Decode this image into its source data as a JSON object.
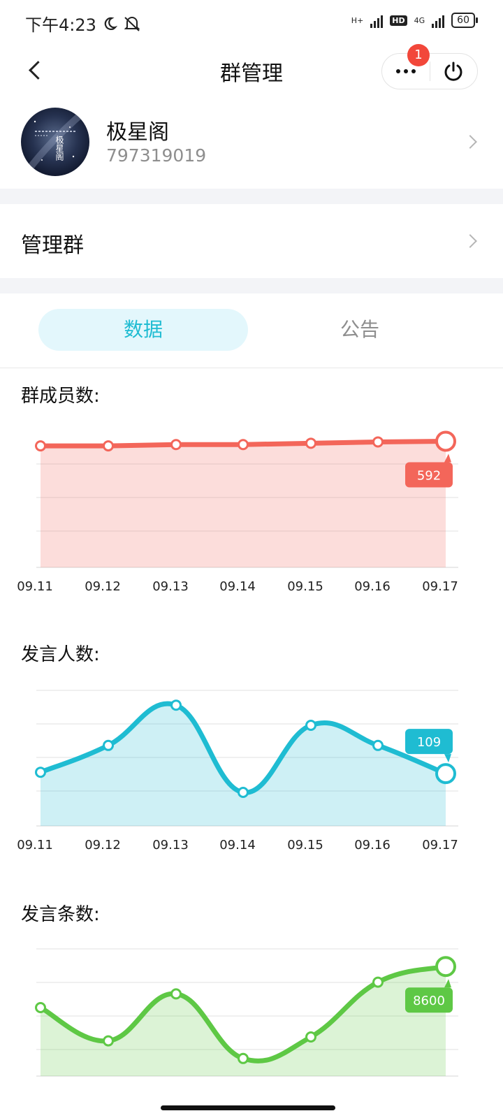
{
  "status_bar": {
    "time": "下午4:23",
    "network_1": "H+",
    "hd": "HD",
    "network_2": "4G",
    "battery": "60",
    "icons": [
      "moon-icon",
      "bell-off-icon",
      "signal-icon",
      "signal-icon",
      "battery-icon"
    ]
  },
  "nav": {
    "title": "群管理",
    "badge_count": "1",
    "icons": [
      "back-icon",
      "more-icon",
      "power-icon"
    ]
  },
  "group": {
    "name": "极星阁",
    "id": "797319019",
    "avatar_text": "极星阁"
  },
  "manage": {
    "label": "管理群"
  },
  "tabs": [
    {
      "label": "数据",
      "active": true
    },
    {
      "label": "公告",
      "active": false
    }
  ],
  "sections": [
    {
      "title": "群成员数:"
    },
    {
      "title": "发言人数:"
    },
    {
      "title": "发言条数:"
    }
  ],
  "colors": {
    "accent": "#1fbcd2",
    "members": "#f3665a",
    "speakers": "#1fbcd2",
    "messages": "#5ec845",
    "badge": "#f2473a"
  },
  "chart_data": [
    {
      "type": "area",
      "title": "群成员数:",
      "categories": [
        "09.11",
        "09.12",
        "09.13",
        "09.14",
        "09.15",
        "09.16",
        "09.17"
      ],
      "values": [
        585,
        585,
        587,
        587,
        589,
        591,
        592
      ],
      "highlight_label": "592",
      "grid": true
    },
    {
      "type": "area",
      "title": "发言人数:",
      "categories": [
        "09.11",
        "09.12",
        "09.13",
        "09.14",
        "09.15",
        "09.16",
        "09.17"
      ],
      "values": [
        110,
        130,
        160,
        95,
        145,
        130,
        109
      ],
      "highlight_label": "109",
      "grid": true
    },
    {
      "type": "area",
      "title": "发言条数:",
      "categories": [
        "09.11",
        "09.12",
        "09.13",
        "09.14",
        "09.15",
        "09.16",
        "09.17"
      ],
      "values": [
        6500,
        4800,
        7200,
        3900,
        5000,
        7800,
        8600
      ],
      "highlight_label": "8600",
      "grid": true
    }
  ]
}
